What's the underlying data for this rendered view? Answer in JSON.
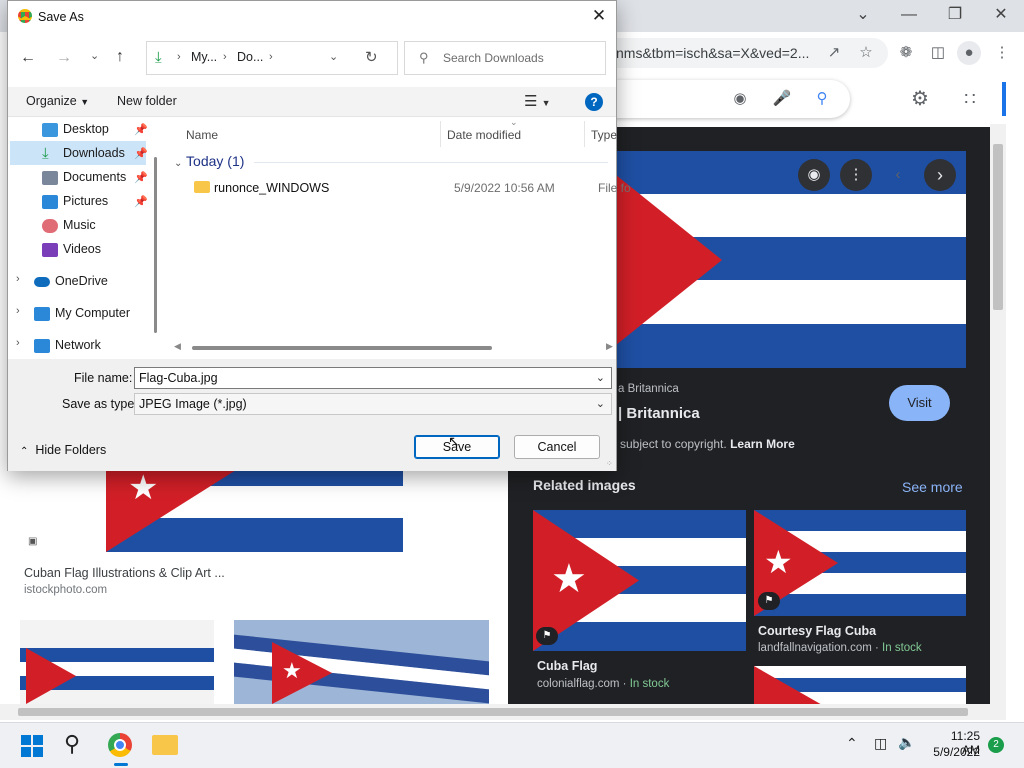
{
  "browser": {
    "url_text": "nms&tbm=isch&sa=X&ved=2...",
    "preview": {
      "source_partial": "a Britannica",
      "title_partial": "| Britannica",
      "visit_label": "Visit",
      "copyright_text": "subject to copyright.",
      "learn_more": "Learn More",
      "related_heading": "Related images",
      "see_more": "See more",
      "related": [
        {
          "title": "Cuba Flag",
          "site": "colonialflag.com",
          "stock": "In stock"
        },
        {
          "title": "Courtesy Flag Cuba",
          "site": "landfallnavigation.com",
          "stock": "In stock"
        }
      ]
    },
    "results": [
      {
        "title": "Cuban Flag Illustrations & Clip Art ...",
        "site": "istockphoto.com"
      }
    ]
  },
  "dialog": {
    "title": "Save As",
    "breadcrumb": [
      "My...",
      "Do..."
    ],
    "search_placeholder": "Search Downloads",
    "organize_label": "Organize",
    "new_folder_label": "New folder",
    "help_glyph": "?",
    "nav_items": [
      {
        "label": "Desktop",
        "icon": "desktop-icon",
        "color": "#3a96dd",
        "pinned": true
      },
      {
        "label": "Downloads",
        "icon": "downloads-icon",
        "color": "#1b9e4b",
        "pinned": true
      },
      {
        "label": "Documents",
        "icon": "documents-icon",
        "color": "#7a869a",
        "pinned": true
      },
      {
        "label": "Pictures",
        "icon": "pictures-icon",
        "color": "#2b88d8",
        "pinned": true
      },
      {
        "label": "Music",
        "icon": "music-icon",
        "color": "#e06c75",
        "pinned": false
      },
      {
        "label": "Videos",
        "icon": "videos-icon",
        "color": "#7a3fb8",
        "pinned": false
      },
      {
        "label": "OneDrive",
        "icon": "onedrive-icon",
        "color": "#0f6cbd",
        "pinned": false
      },
      {
        "label": "My Computer",
        "icon": "computer-icon",
        "color": "#2b88d8",
        "pinned": false
      },
      {
        "label": "Network",
        "icon": "network-icon",
        "color": "#2b88d8",
        "pinned": false
      }
    ],
    "columns": [
      "Name",
      "Date modified",
      "Type"
    ],
    "group_label": "Today (1)",
    "files": [
      {
        "name": "runonce_WINDOWS",
        "date": "5/9/2022 10:56 AM",
        "type": "File fo"
      }
    ],
    "file_name_label": "File name:",
    "file_name_value": "Flag-Cuba.jpg",
    "save_type_label": "Save as type:",
    "save_type_value": "JPEG Image (*.jpg)",
    "hide_folders_label": "Hide Folders",
    "save_label": "Save",
    "cancel_label": "Cancel"
  },
  "taskbar": {
    "time": "11:25 AM",
    "date": "5/9/2022",
    "notification_count": "2"
  },
  "colors": {
    "flag_blue": "#1f4fa3",
    "flag_red": "#d21f27",
    "accent": "#0067c0",
    "in_stock": "#81c995"
  }
}
